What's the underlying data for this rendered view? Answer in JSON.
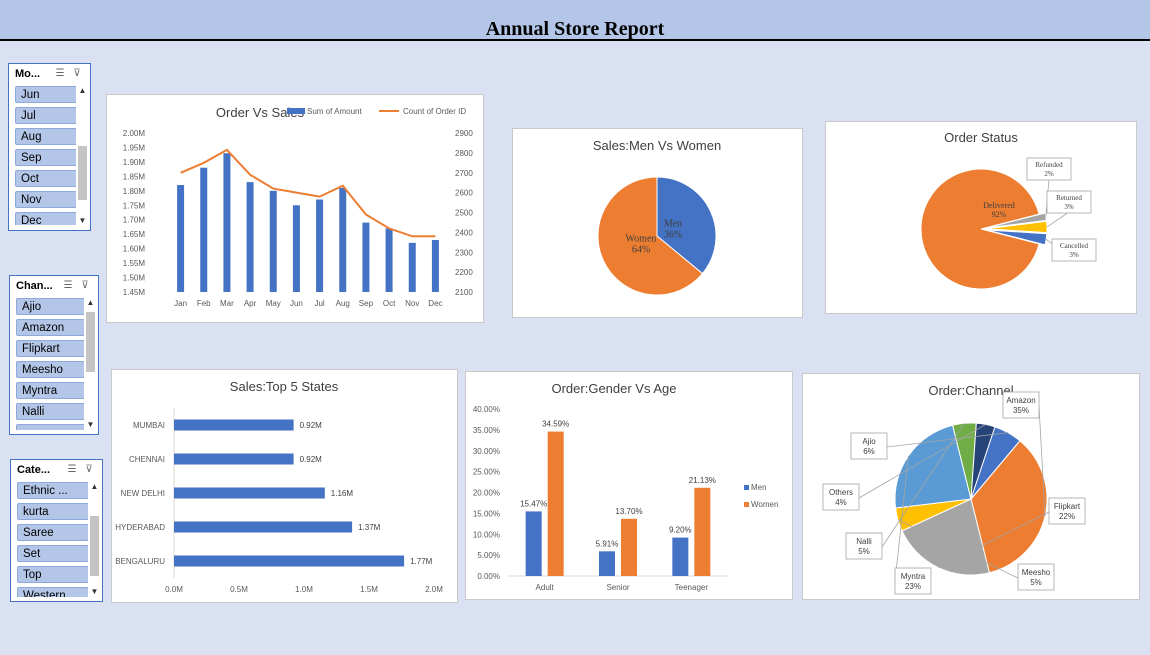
{
  "report": {
    "title": "Annual Store Report"
  },
  "slicers": [
    {
      "id": "month",
      "title": "Mo...",
      "items": [
        "Jun",
        "Jul",
        "Aug",
        "Sep",
        "Oct",
        "Nov",
        "Dec"
      ]
    },
    {
      "id": "channel",
      "title": "Chan...",
      "items": [
        "Ajio",
        "Amazon",
        "Flipkart",
        "Meesho",
        "Myntra",
        "Nalli",
        "..."
      ]
    },
    {
      "id": "category",
      "title": "Cate...",
      "items": [
        "Ethnic ...",
        "kurta",
        "Saree",
        "Set",
        "Top",
        "Western ..."
      ]
    }
  ],
  "chart_data": [
    {
      "id": "order_vs_sales",
      "type": "bar",
      "title": "Order Vs Sales",
      "categories": [
        "Jan",
        "Feb",
        "Mar",
        "Apr",
        "May",
        "Jun",
        "Jul",
        "Aug",
        "Sep",
        "Oct",
        "Nov",
        "Dec"
      ],
      "y_ticks": [
        "2.00M",
        "1.95M",
        "1.90M",
        "1.85M",
        "1.80M",
        "1.75M",
        "1.70M",
        "1.65M",
        "1.60M",
        "1.55M",
        "1.50M",
        "1.45M"
      ],
      "y2_ticks": [
        "2900",
        "2800",
        "2700",
        "2600",
        "2500",
        "2400",
        "2300",
        "2200",
        "2100"
      ],
      "ylim": [
        1.45,
        2.0
      ],
      "y2lim": [
        2100,
        2900
      ],
      "series": [
        {
          "name": "Sum of Amount",
          "type": "bar",
          "axis": "left",
          "color": "#4472c4",
          "values": [
            1.82,
            1.88,
            1.93,
            1.83,
            1.8,
            1.75,
            1.77,
            1.81,
            1.69,
            1.67,
            1.62,
            1.63
          ]
        },
        {
          "name": "Count of Order ID",
          "type": "line",
          "axis": "right",
          "color": "#ed7d31",
          "values": [
            2700,
            2750,
            2815,
            2690,
            2620,
            2600,
            2580,
            2635,
            2490,
            2420,
            2380,
            2380
          ]
        }
      ],
      "legend": "top"
    },
    {
      "id": "men_vs_women",
      "type": "pie",
      "title": "Sales:Men Vs Women",
      "slices": [
        {
          "label": "Men",
          "pct": "36%",
          "value": 36,
          "color": "#4472c4"
        },
        {
          "label": "Women",
          "pct": "64%",
          "value": 64,
          "color": "#ed7d31"
        }
      ]
    },
    {
      "id": "order_status",
      "type": "pie",
      "title": "Order Status",
      "slices": [
        {
          "label": "Delivered",
          "pct": "92%",
          "value": 92,
          "color": "#ed7d31"
        },
        {
          "label": "Refunded",
          "pct": "2%",
          "value": 2,
          "color": "#a5a5a5"
        },
        {
          "label": "Returned",
          "pct": "3%",
          "value": 3,
          "color": "#ffc000"
        },
        {
          "label": "Cancelled",
          "pct": "3%",
          "value": 3,
          "color": "#4472c4"
        }
      ]
    },
    {
      "id": "top5_states",
      "type": "bar",
      "title": "Sales:Top 5 States",
      "orientation": "horizontal",
      "categories": [
        "MUMBAI",
        "CHENNAI",
        "NEW DELHI",
        "HYDERABAD",
        "BENGALURU"
      ],
      "values": [
        0.92,
        0.92,
        1.16,
        1.37,
        1.77
      ],
      "value_labels": [
        "0.92M",
        "0.92M",
        "1.16M",
        "1.37M",
        "1.77M"
      ],
      "x_ticks": [
        "0.0M",
        "0.5M",
        "1.0M",
        "1.5M",
        "2.0M"
      ],
      "xlim": [
        0,
        2.0
      ],
      "color": "#4472c4"
    },
    {
      "id": "gender_vs_age",
      "type": "bar",
      "title": "Order:Gender Vs Age",
      "categories": [
        "Adult",
        "Senior",
        "Teenager"
      ],
      "y_ticks": [
        "40.00%",
        "35.00%",
        "30.00%",
        "25.00%",
        "20.00%",
        "15.00%",
        "10.00%",
        "5.00%",
        "0.00%"
      ],
      "ylim": [
        0,
        40
      ],
      "series": [
        {
          "name": "Men",
          "color": "#4472c4",
          "values": [
            15.47,
            5.91,
            9.2
          ],
          "labels": [
            "15.47%",
            "5.91%",
            "9.20%"
          ]
        },
        {
          "name": "Women",
          "color": "#ed7d31",
          "values": [
            34.59,
            13.7,
            21.13
          ],
          "labels": [
            "34.59%",
            "13.70%",
            "21.13%"
          ]
        }
      ],
      "legend": "right"
    },
    {
      "id": "order_channel",
      "type": "pie",
      "title": "Order:Channel",
      "slices": [
        {
          "label": "Amazon",
          "pct": "35%",
          "value": 35,
          "color": "#ed7d31"
        },
        {
          "label": "Flipkart",
          "pct": "22%",
          "value": 22,
          "color": "#a5a5a5"
        },
        {
          "label": "Meesho",
          "pct": "5%",
          "value": 5,
          "color": "#ffc000"
        },
        {
          "label": "Myntra",
          "pct": "23%",
          "value": 23,
          "color": "#5b9bd5"
        },
        {
          "label": "Nalli",
          "pct": "5%",
          "value": 5,
          "color": "#70ad47"
        },
        {
          "label": "Others",
          "pct": "4%",
          "value": 4,
          "color": "#264478"
        },
        {
          "label": "Ajio",
          "pct": "6%",
          "value": 6,
          "color": "#4472c4"
        }
      ]
    }
  ]
}
